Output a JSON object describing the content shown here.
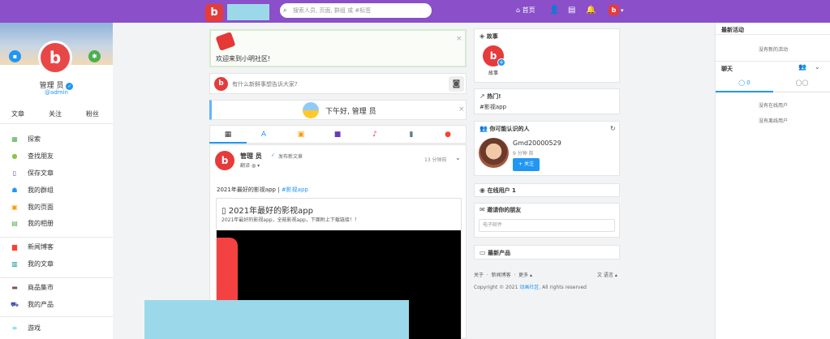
{
  "topbar": {
    "logo_text": "b",
    "search_placeholder": "搜索人员, 页面, 群组 或 #标签",
    "home_label": "首页",
    "caret": "▾"
  },
  "profile": {
    "name": "管理 员",
    "handle": "@admin",
    "verified": "✓",
    "tabs": [
      "文章",
      "关注",
      "粉丝"
    ]
  },
  "menu": [
    {
      "icon": "compass-icon",
      "glyph": "▦",
      "color": "#4caf50",
      "label": "探索"
    },
    {
      "icon": "map-pin-icon",
      "glyph": "●",
      "color": "#8bc34a",
      "label": "查找朋友"
    },
    {
      "icon": "bookmark-icon",
      "glyph": "▯",
      "color": "#673ab7",
      "label": "保存文章"
    },
    {
      "icon": "group-icon",
      "glyph": "☗",
      "color": "#2196f3",
      "label": "我的群组"
    },
    {
      "icon": "page-icon",
      "glyph": "▣",
      "color": "#ff9800",
      "label": "我的页面"
    },
    {
      "icon": "album-icon",
      "glyph": "▤",
      "color": "#4caf50",
      "label": "我的相册"
    },
    {
      "icon": "newspaper-icon",
      "glyph": "▆",
      "color": "#f44336",
      "label": "新闻博客"
    },
    {
      "icon": "book-icon",
      "glyph": "▥",
      "color": "#009688",
      "label": "我的文章"
    },
    {
      "icon": "store-icon",
      "glyph": "▬",
      "color": "#795548",
      "label": "商品集市"
    },
    {
      "icon": "cart-icon",
      "glyph": "⛟",
      "color": "#3f51b5",
      "label": "我的产品"
    },
    {
      "icon": "gamepad-icon",
      "glyph": "∞",
      "color": "#00bcd4",
      "label": "游戏"
    }
  ],
  "welcome": {
    "text": "欢迎来到小明社区!",
    "close": "×"
  },
  "composer": {
    "placeholder": "有什么新鲜事想告诉大家?"
  },
  "greeting": {
    "text": "下午好, 管理 员",
    "close": "×"
  },
  "post": {
    "author": "管理 员",
    "action": "发布新文章",
    "time": "13 分钟前",
    "translate": "翻译",
    "body_prefix": "2021年最好的影视app | ",
    "hashtag": "#影视app",
    "article_title": "2021年最好的影视app",
    "article_desc": "2021年最好的影视app，全能影视app，下面附上下载链接！！"
  },
  "right": {
    "stories": {
      "title": "故事",
      "label": "故事"
    },
    "trending": {
      "title": "热门!",
      "tag": "#影视app"
    },
    "suggest": {
      "title": "你可能认识的人",
      "name": "Gmd20000529",
      "time": "9 分钟 前",
      "follow": "关注"
    },
    "online": {
      "title": "在线用户 1"
    },
    "invite": {
      "title": "邀请你的朋友",
      "placeholder": "电子邮件"
    },
    "products": {
      "title": "最新产品"
    },
    "footer": {
      "about": "关于",
      "news": "新闻博客",
      "more": "更多",
      "language": "语言",
      "copyright_prefix": "Copyright © 2021 ",
      "copyright_link": "动画社区",
      "copyright_suffix": ". All rights reserved"
    }
  },
  "activity": {
    "title": "最新活动",
    "empty": "没有新的活动"
  },
  "chat": {
    "title": "聊天",
    "online_count": "0",
    "no_online": "没有在线用户",
    "no_offline": "没有离线用户"
  }
}
